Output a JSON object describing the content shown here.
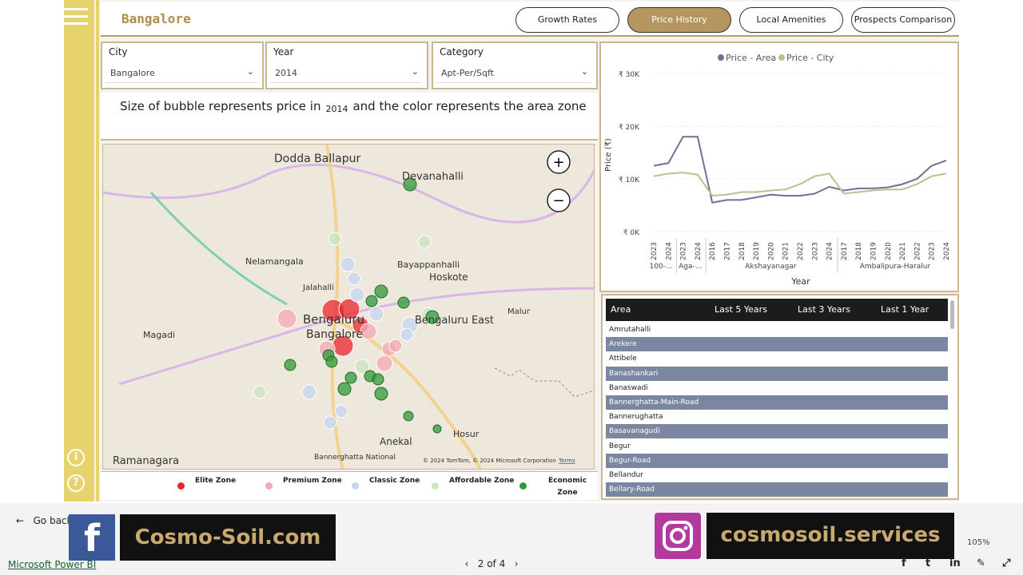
{
  "header": {
    "city": "Bangalore",
    "nav": [
      "Growth Rates",
      "Price History",
      "Local Amenities",
      "Prospects Comparison"
    ]
  },
  "slicers": {
    "city": {
      "label": "City",
      "value": "Bangalore"
    },
    "year": {
      "label": "Year",
      "value": "2014"
    },
    "category": {
      "label": "Category",
      "value": "Apt-Per/Sqft"
    }
  },
  "caption": {
    "pre": "Size of bubble represents price in",
    "year": "2014",
    "post": "and the color represents the area zone"
  },
  "map": {
    "places": [
      {
        "name": "Dodda Ballapur"
      },
      {
        "name": "Devanahalli"
      },
      {
        "name": "Nelamangala"
      },
      {
        "name": "Bayappanhalli"
      },
      {
        "name": "Hoskote"
      },
      {
        "name": "Jalahalli"
      },
      {
        "name": "Magadi"
      },
      {
        "name": "Bengaluru"
      },
      {
        "name": "Bangalore"
      },
      {
        "name": "Bengaluru East"
      },
      {
        "name": "Malur"
      },
      {
        "name": "Ramanagara"
      },
      {
        "name": "Bannerghatta National"
      },
      {
        "name": "Anekal"
      },
      {
        "name": "Hosur"
      }
    ],
    "attribution": "© 2024 TomTom, © 2024 Microsoft Corporation",
    "terms": "Terms",
    "zoom_in": "+",
    "zoom_out": "−"
  },
  "zones": [
    {
      "name": "Elite Zone",
      "color": "#e8262d"
    },
    {
      "name": "Premium Zone",
      "color": "#f5a7b3"
    },
    {
      "name": "Classic Zone",
      "color": "#c7d6ef"
    },
    {
      "name": "Affordable Zone",
      "color": "#c9e6c0"
    },
    {
      "name": "Economic Zone",
      "color": "#2f9a3b"
    }
  ],
  "chart_data": {
    "type": "line",
    "title": "",
    "legend": [
      "Price - Area",
      "Price - City"
    ],
    "legend_position": "top",
    "ylabel": "Price (₹)",
    "xlabel": "Year",
    "yticks": [
      "₹ 0K",
      "₹ 10K",
      "₹ 20K",
      "₹ 30K"
    ],
    "ylim": [
      0,
      30000
    ],
    "x": [
      "2023",
      "2024",
      "2023",
      "2024",
      "2016",
      "2017",
      "2018",
      "2019",
      "2020",
      "2021",
      "2022",
      "2023",
      "2024",
      "2017",
      "2018",
      "2019",
      "2020",
      "2021",
      "2022",
      "2023",
      "2024"
    ],
    "groups": [
      {
        "label": "100-...",
        "count": 2
      },
      {
        "label": "Aga-...",
        "count": 2
      },
      {
        "label": "Akshayanagar",
        "count": 9
      },
      {
        "label": "Ambalipura-Haralur",
        "count": 8
      }
    ],
    "series": [
      {
        "name": "Price - Area",
        "color": "#6b7394",
        "values": [
          12500,
          13000,
          18000,
          18000,
          5500,
          6000,
          6000,
          6500,
          7000,
          6800,
          6800,
          7200,
          8500,
          7800,
          8200,
          8200,
          8400,
          9000,
          10000,
          12500,
          13500
        ]
      },
      {
        "name": "Price - City",
        "color": "#bcc08f",
        "values": [
          10500,
          11000,
          11200,
          10800,
          6800,
          7000,
          7500,
          7500,
          7800,
          8000,
          9000,
          10500,
          11000,
          7200,
          7500,
          7800,
          8000,
          8000,
          9000,
          10500,
          11000
        ]
      }
    ]
  },
  "table": {
    "headers": [
      "Area",
      "Last 5 Years",
      "Last 3 Years",
      "Last 1 Year"
    ],
    "rows": [
      "Amrutahalli",
      "Arekere",
      "Attibele",
      "Banashankari",
      "Banaswadi",
      "Bannerghatta-Main-Road",
      "Bannerughatta",
      "Basavanagudi",
      "Begur",
      "Begur-Road",
      "Bellandur",
      "Bellary-Road"
    ]
  },
  "footer": {
    "go_back": "Go back",
    "brand": "Microsoft Power BI",
    "page": "2 of 4",
    "zoom": "105%",
    "site": "Cosmo-Soil.com",
    "ig_handle": "cosmosoil.services",
    "fb_letter": "f"
  }
}
